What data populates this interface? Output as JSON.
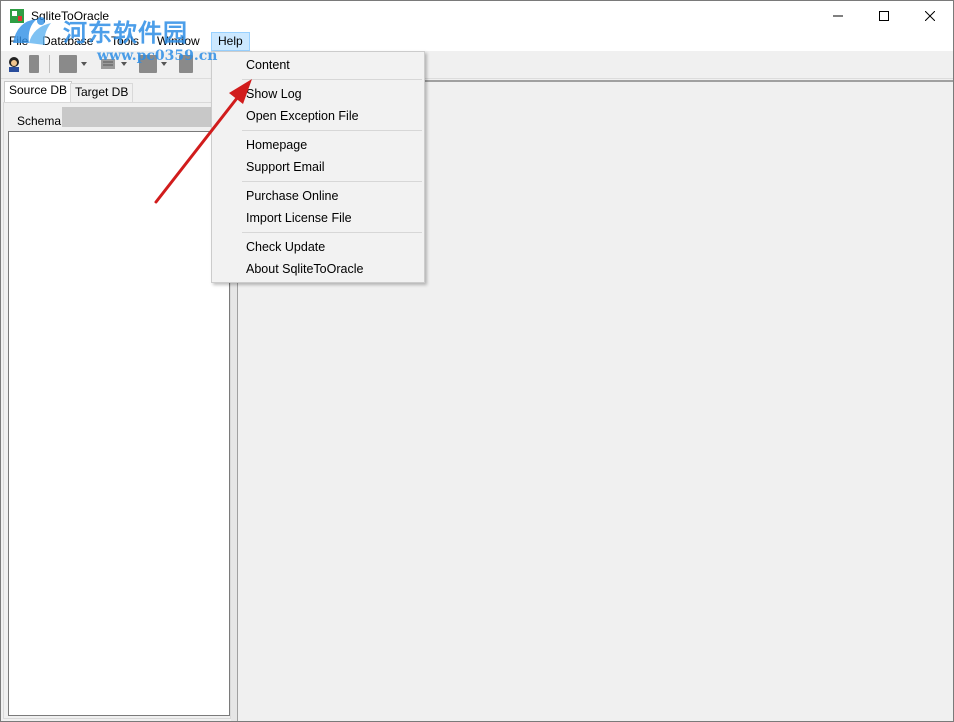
{
  "window": {
    "title": "SqliteToOracle"
  },
  "menubar": {
    "file": "File",
    "database": "Database",
    "tools": "Tools",
    "window": "Window",
    "help": "Help"
  },
  "left_panel": {
    "tabs": [
      "Source DB",
      "Target DB"
    ],
    "schema_label": "Schema"
  },
  "help_menu": {
    "items": [
      "Content",
      "Show Log",
      "Open Exception File",
      "Homepage",
      "Support Email",
      "Purchase Online",
      "Import License File",
      "Check Update",
      "About SqliteToOracle"
    ]
  },
  "watermark": {
    "title": "河东软件园",
    "url": "www.pc0359.cn"
  },
  "colors": {
    "menu_highlight": "#cce8ff",
    "watermark": "#2d8ee6",
    "arrow": "#d11c1c"
  }
}
